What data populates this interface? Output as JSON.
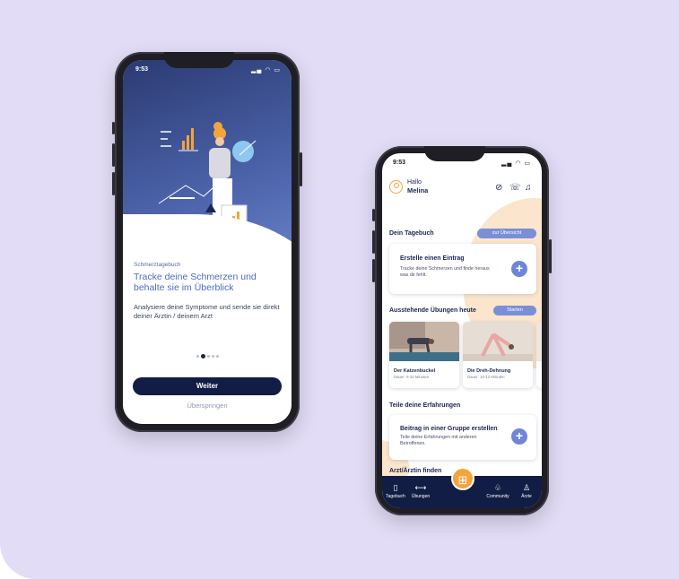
{
  "colors": {
    "background": "#e2dcf6",
    "navy": "#111d44",
    "accent_blue": "#6f86d6",
    "orange": "#f4a43c"
  },
  "phone1": {
    "status_time": "9:53",
    "status_icons": "signal-wifi-battery-icons",
    "subtitle": "Schmerztagebuch",
    "title": "Tracke deine Schmerzen und behalte sie im Überblick",
    "description": "Analysiere deine Symptome und sende sie direkt deiner Ärztin / deinem Arzt",
    "pager": {
      "count": 5,
      "active_index": 1
    },
    "primary_button": "Weiter",
    "secondary_link": "Überspringen"
  },
  "phone2": {
    "status_time": "9:53",
    "greeting": "Hallo",
    "user_name": "Melina",
    "header_icons": [
      "pill-icon",
      "chat-icon",
      "bell-icon"
    ],
    "diary": {
      "section_title": "Dein Tagebuch",
      "overview_button": "zur Übersicht",
      "card_title": "Erstelle einen Eintrag",
      "card_text": "Tracke deine Schmerzen und finde heraus was dir fehlt."
    },
    "exercises": {
      "section_title": "Ausstehende Übungen heute",
      "start_button": "Starten",
      "items": [
        {
          "name": "Der Katzenbuckel",
          "duration": "Dauer: 5-10 Minuten"
        },
        {
          "name": "Die Dreh-Dehnung",
          "duration": "Dauer: 10-12 Minuten"
        }
      ]
    },
    "community": {
      "section_title": "Teile deine Erfahrungen",
      "card_title": "Beitrag in einer Gruppe erstellen",
      "card_text": "Teile deine Erfahrungen mit anderen Betroffenen."
    },
    "doctor_section_title": "Arzt/Ärztin finden",
    "nav": [
      {
        "label": "Tagebuch",
        "icon": "book-icon"
      },
      {
        "label": "Übungen",
        "icon": "dumbbell-icon"
      },
      {
        "label": "Community",
        "icon": "community-icon"
      },
      {
        "label": "Ärzte",
        "icon": "doctor-icon"
      }
    ],
    "center_action_icon": "grid-icon"
  }
}
